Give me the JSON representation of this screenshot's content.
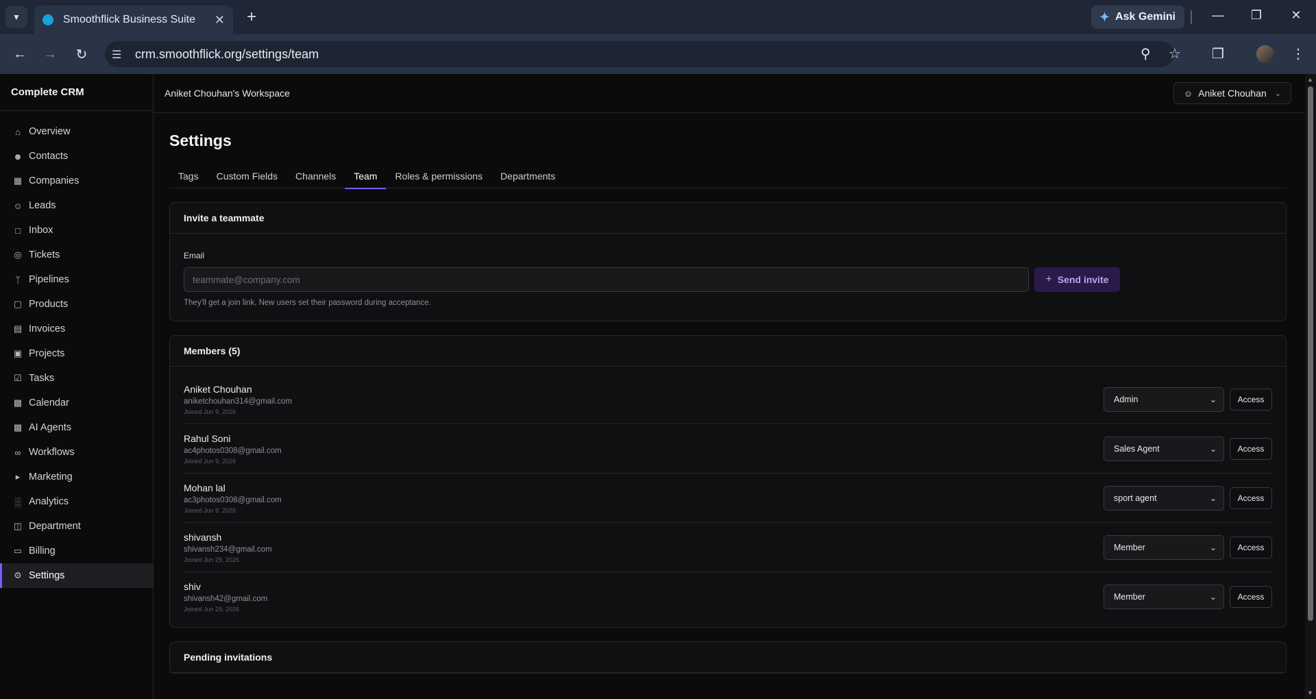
{
  "browser": {
    "tab_title": "Smoothflick Business Suite",
    "url": "crm.smoothflick.org/settings/team",
    "gemini_label": "Ask Gemini"
  },
  "app": {
    "brand": "Complete CRM",
    "workspace": "Aniket Chouhan's Workspace",
    "user_name": "Aniket Chouhan",
    "accent": "#7c5cff"
  },
  "sidebar": {
    "items": [
      {
        "label": "Overview",
        "icon": "home-icon"
      },
      {
        "label": "Contacts",
        "icon": "users-icon"
      },
      {
        "label": "Companies",
        "icon": "building-icon"
      },
      {
        "label": "Leads",
        "icon": "user-plus-icon"
      },
      {
        "label": "Inbox",
        "icon": "message-icon"
      },
      {
        "label": "Tickets",
        "icon": "lifebuoy-icon"
      },
      {
        "label": "Pipelines",
        "icon": "branch-icon"
      },
      {
        "label": "Products",
        "icon": "box-icon"
      },
      {
        "label": "Invoices",
        "icon": "file-icon"
      },
      {
        "label": "Projects",
        "icon": "folder-icon"
      },
      {
        "label": "Tasks",
        "icon": "checkbox-icon"
      },
      {
        "label": "Calendar",
        "icon": "calendar-icon"
      },
      {
        "label": "AI Agents",
        "icon": "bot-icon"
      },
      {
        "label": "Workflows",
        "icon": "workflow-icon"
      },
      {
        "label": "Marketing",
        "icon": "megaphone-icon"
      },
      {
        "label": "Analytics",
        "icon": "chart-icon"
      },
      {
        "label": "Department",
        "icon": "org-icon"
      },
      {
        "label": "Billing",
        "icon": "card-icon"
      },
      {
        "label": "Settings",
        "icon": "gear-icon",
        "active": true
      }
    ]
  },
  "settings": {
    "title": "Settings",
    "tabs": [
      "Tags",
      "Custom Fields",
      "Channels",
      "Team",
      "Roles & permissions",
      "Departments"
    ],
    "active_tab": "Team"
  },
  "invite": {
    "heading": "Invite a teammate",
    "email_label": "Email",
    "email_placeholder": "teammate@company.com",
    "send_label": "Send invite",
    "hint": "They'll get a join link. New users set their password during acceptance."
  },
  "members": {
    "heading": "Members (5)",
    "access_label": "Access",
    "list": [
      {
        "name": "Aniket Chouhan",
        "email": "aniketchouhan314@gmail.com",
        "joined": "Joined Jun 9, 2026",
        "role": "Admin"
      },
      {
        "name": "Rahul Soni",
        "email": "ac4photos0308@gmail.com",
        "joined": "Joined Jun 9, 2026",
        "role": "Sales Agent"
      },
      {
        "name": "Mohan lal",
        "email": "ac3photos0308@gmail.com",
        "joined": "Joined Jun 9, 2026",
        "role": "sport agent"
      },
      {
        "name": "shivansh",
        "email": "shivansh234@gmail.com",
        "joined": "Joined Jun 29, 2026",
        "role": "Member"
      },
      {
        "name": "shiv",
        "email": "shivansh42@gmail.com",
        "joined": "Joined Jun 29, 2026",
        "role": "Member"
      }
    ]
  },
  "pending": {
    "heading": "Pending invitations"
  }
}
